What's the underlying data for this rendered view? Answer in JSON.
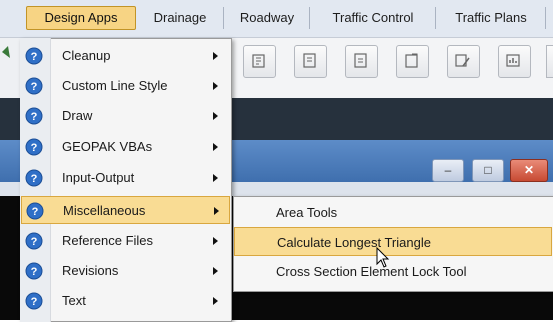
{
  "menubar": {
    "items": [
      {
        "label": "Design Apps",
        "active": true
      },
      {
        "label": "Drainage",
        "active": false
      },
      {
        "label": "Roadway",
        "active": false
      },
      {
        "label": "Traffic Control",
        "active": false
      },
      {
        "label": "Traffic Plans",
        "active": false
      }
    ]
  },
  "toolbar": {
    "buttons": [
      "cell-icon",
      "text-edit-icon",
      "note-icon",
      "note-export-icon",
      "pencil-icon",
      "chart-icon"
    ]
  },
  "window_controls": {
    "minimize": "–",
    "restore": "□",
    "close": "✕"
  },
  "dropdown": {
    "items": [
      {
        "label": "Cleanup",
        "icon": "help-circle-icon",
        "has_submenu": true
      },
      {
        "label": "Custom Line Style",
        "icon": "help-circle-icon",
        "has_submenu": true
      },
      {
        "label": "Draw",
        "icon": "help-circle-icon",
        "has_submenu": true
      },
      {
        "label": "GEOPAK VBAs",
        "icon": "help-circle-icon",
        "has_submenu": true
      },
      {
        "label": "Input-Output",
        "icon": "help-circle-icon",
        "has_submenu": true
      },
      {
        "label": "Miscellaneous",
        "icon": "help-circle-icon",
        "has_submenu": true,
        "highlighted": true
      },
      {
        "label": "Reference Files",
        "icon": "help-circle-icon",
        "has_submenu": true
      },
      {
        "label": "Revisions",
        "icon": "help-circle-icon",
        "has_submenu": true
      },
      {
        "label": "Text",
        "icon": "help-circle-icon",
        "has_submenu": true
      }
    ]
  },
  "submenu": {
    "items": [
      {
        "label": "Area Tools"
      },
      {
        "label": "Calculate Longest Triangle",
        "highlighted": true
      },
      {
        "label": "Cross Section Element Lock Tool"
      }
    ]
  },
  "colors": {
    "highlight": "#f9dc94",
    "highlight_border": "#d9a73f",
    "icon_blue": "#2f6fc7",
    "titlebar": "#4c7cbc"
  }
}
